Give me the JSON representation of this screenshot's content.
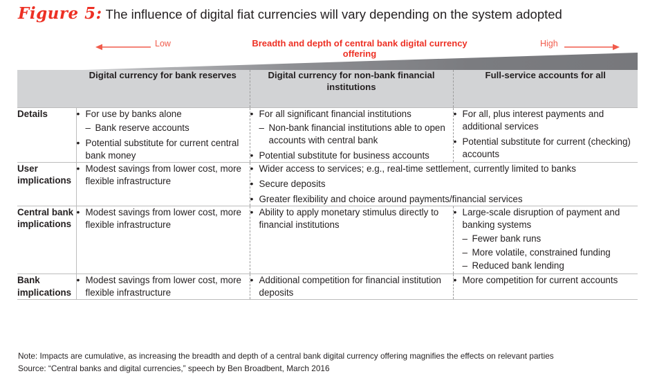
{
  "figure": {
    "label": "Figure 5:",
    "title": "The influence of digital fiat currencies will vary depending on the system adopted"
  },
  "scale": {
    "low_label": "Low",
    "high_label": "High",
    "center_label": "Breadth and depth of central bank digital currency offering",
    "accent_color": "#ed3024",
    "light_accent_color": "#f15b4b"
  },
  "table": {
    "headers": [
      "",
      "Digital currency for bank reserves",
      "Digital currency for non-bank financial institutions",
      "Full-service accounts for all"
    ],
    "rows": [
      {
        "label": "Details",
        "cells": [
          {
            "items": [
              {
                "text": "For use by banks alone",
                "sub": [
                  "Bank reserve accounts"
                ]
              },
              {
                "text": "Potential substitute for current central bank money",
                "sub": []
              }
            ]
          },
          {
            "items": [
              {
                "text": "For all significant financial institutions",
                "sub": [
                  "Non-bank financial institutions able to open accounts with central bank"
                ]
              },
              {
                "text": "Potential substitute for business accounts",
                "sub": []
              }
            ]
          },
          {
            "items": [
              {
                "text": "For all, plus interest payments and additional services",
                "sub": []
              },
              {
                "text": "Potential substitute for current (checking) accounts",
                "sub": []
              }
            ]
          }
        ]
      },
      {
        "label": "User implications",
        "cells": [
          {
            "items": [
              {
                "text": "Modest savings from lower cost, more flexible infrastructure",
                "sub": []
              }
            ]
          },
          {
            "merged": true,
            "items": [
              {
                "text": "Wider access to services; e.g., real-time settlement, currently limited to banks",
                "sub": []
              },
              {
                "text": "Secure deposits",
                "sub": []
              },
              {
                "text": "Greater flexibility and choice around payments/financial services",
                "sub": []
              }
            ]
          }
        ]
      },
      {
        "label": "Central bank implications",
        "cells": [
          {
            "items": [
              {
                "text": "Modest savings from lower cost, more flexible infrastructure",
                "sub": []
              }
            ]
          },
          {
            "items": [
              {
                "text": "Ability to apply monetary stimulus directly to financial institutions",
                "sub": []
              }
            ]
          },
          {
            "items": [
              {
                "text": "Large-scale disruption of payment and banking systems",
                "sub": [
                  "Fewer bank runs",
                  "More volatile, constrained funding",
                  "Reduced bank lending"
                ]
              }
            ]
          }
        ]
      },
      {
        "label": "Bank implications",
        "cells": [
          {
            "items": [
              {
                "text": "Modest savings from lower cost, more flexible infrastructure",
                "sub": []
              }
            ]
          },
          {
            "items": [
              {
                "text": "Additional competition for financial institution deposits",
                "sub": []
              }
            ]
          },
          {
            "items": [
              {
                "text": "More competition for current accounts",
                "sub": []
              }
            ]
          }
        ]
      }
    ]
  },
  "footnotes": {
    "note": "Note: Impacts are cumulative, as increasing the breadth and depth of a central bank digital currency offering magnifies the effects on relevant parties",
    "source": "Source: “Central banks and digital currencies,” speech by Ben Broadbent, March 2016"
  }
}
